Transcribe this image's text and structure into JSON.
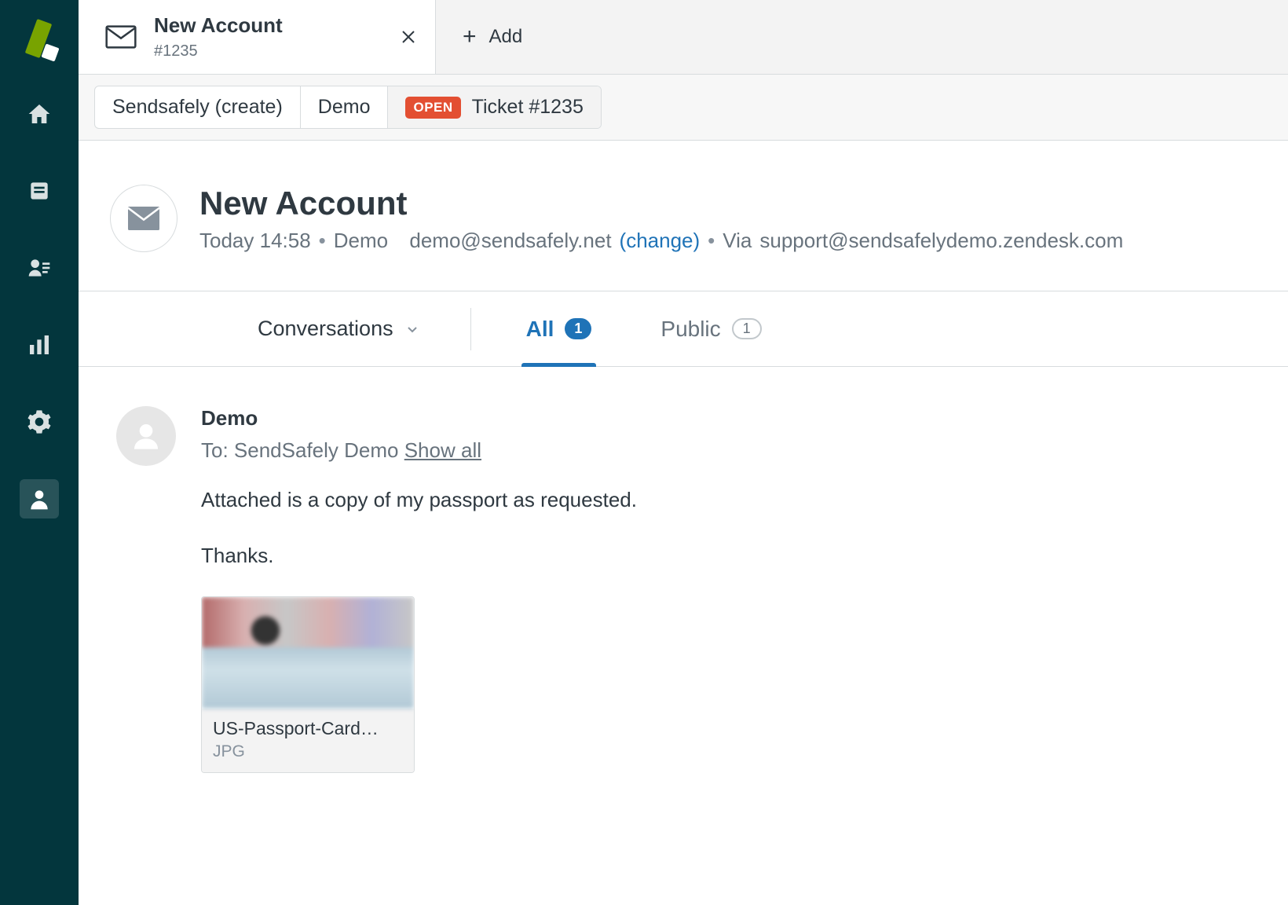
{
  "tab": {
    "title": "New Account",
    "subtitle": "#1235",
    "add_label": "Add"
  },
  "breadcrumb": {
    "items": [
      "Sendsafely (create)",
      "Demo"
    ],
    "status_badge": "OPEN",
    "ticket_label": "Ticket #1235"
  },
  "ticket": {
    "subject": "New Account",
    "time": "Today 14:58",
    "requester": "Demo",
    "email": "demo@sendsafely.net",
    "change_label": "(change)",
    "via_label": "Via",
    "via_email": "support@sendsafelydemo.zendesk.com"
  },
  "filters": {
    "dropdown_label": "Conversations",
    "tabs": [
      {
        "label": "All",
        "count": "1",
        "active": true
      },
      {
        "label": "Public",
        "count": "1",
        "active": false
      }
    ]
  },
  "message": {
    "from": "Demo",
    "to_prefix": "To:",
    "to_name": "SendSafely Demo",
    "show_all": "Show all",
    "body_line1": "Attached is a copy of my passport as requested.",
    "body_line2": "Thanks."
  },
  "attachment": {
    "name": "US-Passport-Card…",
    "type": "JPG"
  },
  "icons": {
    "home": "home-icon",
    "views": "views-icon",
    "customers": "customers-icon",
    "reporting": "reporting-icon",
    "admin": "admin-icon",
    "agent": "agent-icon"
  }
}
